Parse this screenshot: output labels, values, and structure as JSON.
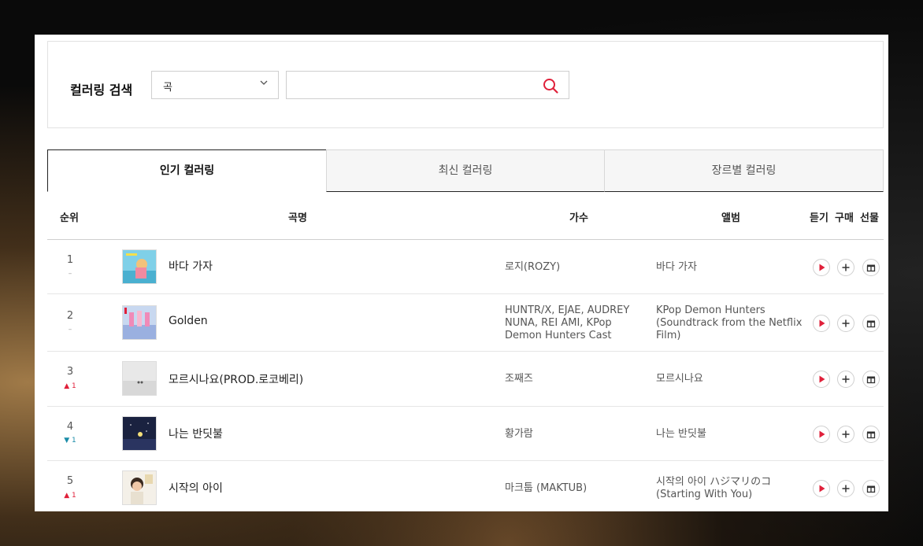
{
  "search": {
    "title": "컬러링 검색",
    "select_value": "곡",
    "input_value": "",
    "input_placeholder": ""
  },
  "tabs": [
    {
      "label": "인기 컬러링",
      "active": true
    },
    {
      "label": "최신 컬러링",
      "active": false
    },
    {
      "label": "장르별 컬러링",
      "active": false
    }
  ],
  "table": {
    "headers": {
      "rank": "순위",
      "song": "곡명",
      "artist": "가수",
      "album": "앨범",
      "listen": "듣기",
      "buy": "구매",
      "gift": "선물"
    },
    "rows": [
      {
        "rank": "1",
        "change": "–",
        "change_dir": "none",
        "title": "바다 가자",
        "artist": "로지(ROZY)",
        "album": "바다 가자"
      },
      {
        "rank": "2",
        "change": "–",
        "change_dir": "none",
        "title": "Golden",
        "artist": "HUNTR/X, EJAE, AUDREY NUNA, REI AMI, KPop Demon Hunters Cast",
        "album": "KPop Demon Hunters (Soundtrack from the Netflix Film)"
      },
      {
        "rank": "3",
        "change": "1",
        "change_dir": "up",
        "title": "모르시나요(PROD.로코베리)",
        "artist": "조째즈",
        "album": "모르시나요"
      },
      {
        "rank": "4",
        "change": "1",
        "change_dir": "down",
        "title": "나는 반딧불",
        "artist": "황가람",
        "album": "나는 반딧불"
      },
      {
        "rank": "5",
        "change": "1",
        "change_dir": "up",
        "title": "시작의 아이",
        "artist": "마크툽 (MAKTUB)",
        "album": "시작의 아이 ハジマリのコ (Starting With You)"
      }
    ]
  },
  "colors": {
    "accent": "#e0203a",
    "down": "#1a8ca8"
  }
}
